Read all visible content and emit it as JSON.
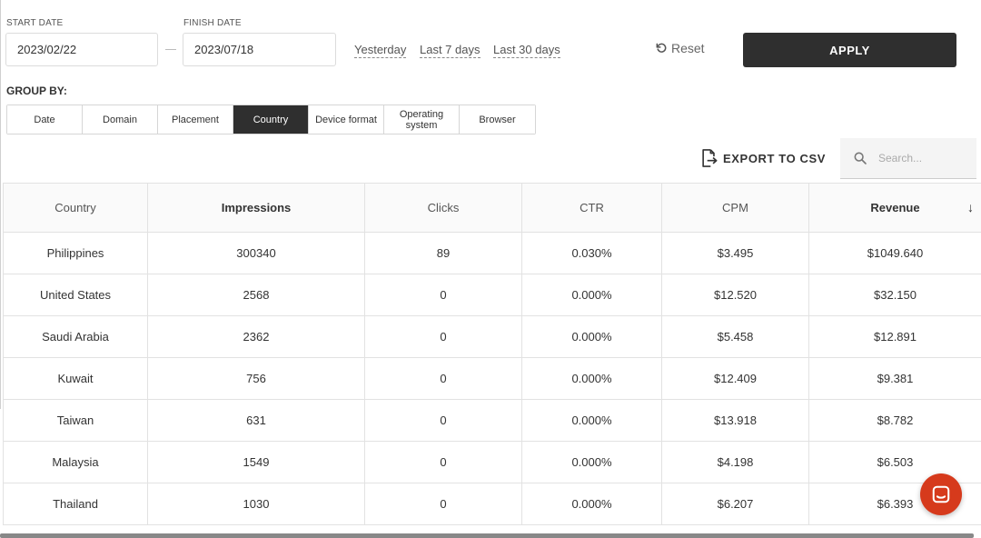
{
  "filters": {
    "start_label": "START DATE",
    "start_value": "2023/02/22",
    "finish_label": "FINISH DATE",
    "finish_value": "2023/07/18",
    "quick_ranges": [
      "Yesterday",
      "Last 7 days",
      "Last 30 days"
    ],
    "reset_label": "Reset",
    "apply_label": "APPLY"
  },
  "group_by": {
    "label": "GROUP BY:",
    "options": [
      "Date",
      "Domain",
      "Placement",
      "Country",
      "Device format",
      "Operating system",
      "Browser"
    ],
    "selected": "Country"
  },
  "toolbar": {
    "export_label": "EXPORT TO CSV",
    "search_placeholder": "Search..."
  },
  "table": {
    "columns": [
      "Country",
      "Impressions",
      "Clicks",
      "CTR",
      "CPM",
      "Revenue"
    ],
    "sort_column": "Revenue",
    "sort_direction": "desc",
    "rows": [
      [
        "Philippines",
        "300340",
        "89",
        "0.030%",
        "$3.495",
        "$1049.640"
      ],
      [
        "United States",
        "2568",
        "0",
        "0.000%",
        "$12.520",
        "$32.150"
      ],
      [
        "Saudi Arabia",
        "2362",
        "0",
        "0.000%",
        "$5.458",
        "$12.891"
      ],
      [
        "Kuwait",
        "756",
        "0",
        "0.000%",
        "$12.409",
        "$9.381"
      ],
      [
        "Taiwan",
        "631",
        "0",
        "0.000%",
        "$13.918",
        "$8.782"
      ],
      [
        "Malaysia",
        "1549",
        "0",
        "0.000%",
        "$4.198",
        "$6.503"
      ],
      [
        "Thailand",
        "1030",
        "0",
        "0.000%",
        "$6.207",
        "$6.393"
      ]
    ]
  },
  "colors": {
    "accent_dark": "#2f2f2f",
    "chat_button": "#d63a1c"
  },
  "icons": {
    "reset": "rotate-ccw-icon",
    "export": "file-export-icon",
    "search": "search-icon",
    "sort": "arrow-down-icon",
    "chat": "chat-bubble-icon"
  }
}
